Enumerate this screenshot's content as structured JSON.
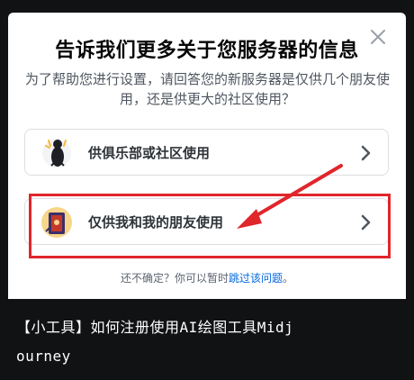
{
  "dialog": {
    "title": "告诉我们更多关于您服务器的信息",
    "subtitle": "为了帮助您进行设置，请回答您的新服务器是仅供几个朋友使用，还是供更大的社区使用？",
    "close_icon": "close-icon"
  },
  "options": [
    {
      "label": "供俱乐部或社区使用",
      "icon": "club-community-icon"
    },
    {
      "label": "仅供我和我的朋友使用",
      "icon": "me-and-friends-icon"
    }
  ],
  "footer": {
    "prefix": "还不确定？你可以暂时",
    "link": "跳过该问题",
    "suffix": "。"
  },
  "caption": {
    "line1": "【小工具】如何注册使用AI绘图工具Midj",
    "line2": "ourney"
  },
  "colors": {
    "highlight": "#e0262b",
    "link": "#0068e0",
    "background": "#111214"
  }
}
